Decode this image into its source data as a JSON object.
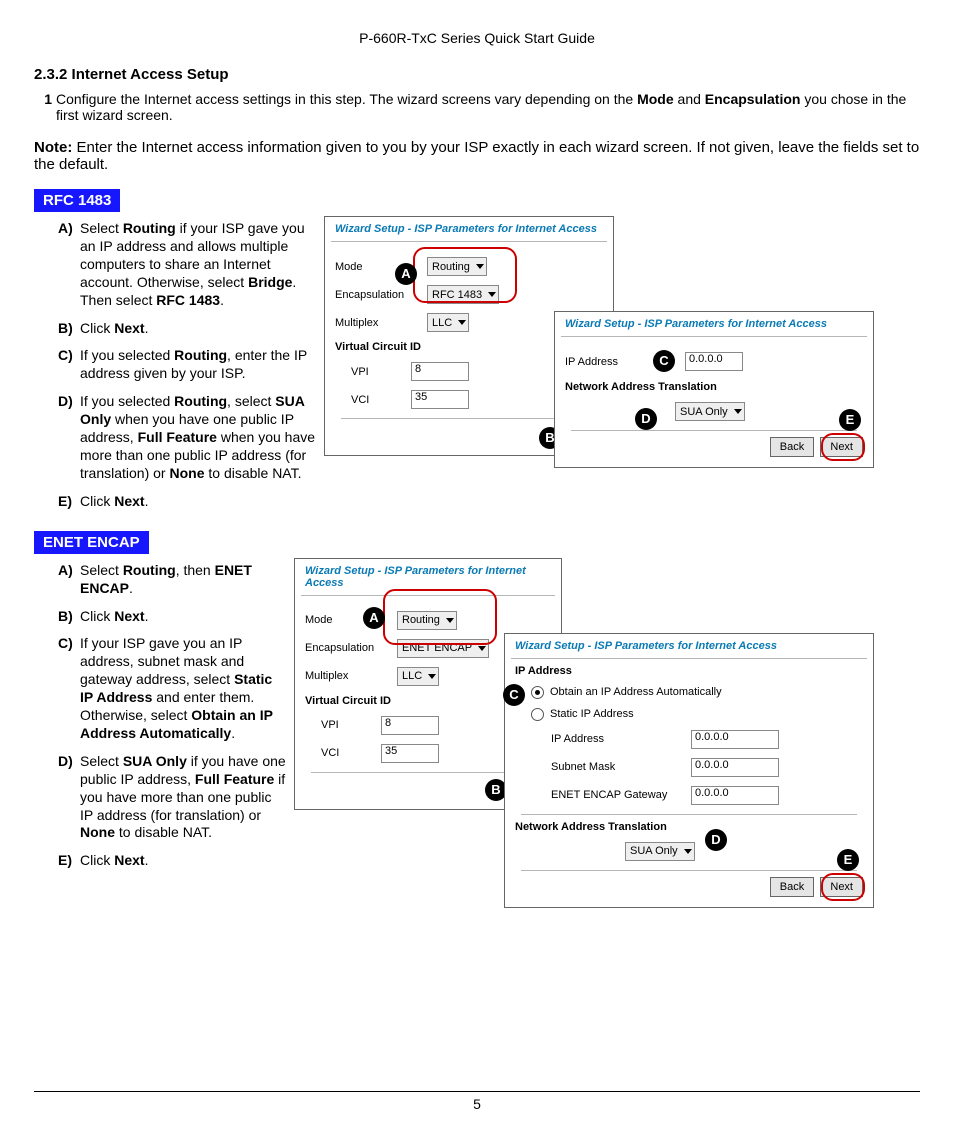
{
  "header": "P-660R-TxC Series Quick Start Guide",
  "page_number": "5",
  "heading": "2.3.2 Internet Access Setup",
  "step1_num": "1",
  "step1_a": "Configure the Internet access settings in this step. The wizard screens vary depending on the ",
  "step1_b": "Mode",
  "step1_c": " and ",
  "step1_d": "Encapsulation",
  "step1_e": " you chose in the first wizard screen.",
  "note_label": "Note:",
  "note_text": " Enter the Internet access information given to you by your ISP exactly in each wizard screen. If not given, leave the fields set to the default.",
  "rfc": {
    "tag": "RFC 1483",
    "A_pre": "Select ",
    "A_b1": "Routing",
    "A_mid": " if your ISP gave you an IP address and allows multiple computers to share an Internet account. Otherwise, select ",
    "A_b2": "Bridge",
    "A_mid2": ". Then select ",
    "A_b3": "RFC 1483",
    "A_end": ".",
    "B_pre": "Click ",
    "B_b": "Next",
    "B_end": ".",
    "C_pre": "If you selected ",
    "C_b": "Routing",
    "C_end": ", enter the IP address given by your ISP.",
    "D_pre": "If you selected ",
    "D_b1": "Routing",
    "D_mid": ", select ",
    "D_b2": "SUA Only",
    "D_mid2": " when you have one public IP address, ",
    "D_b3": "Full Feature",
    "D_mid3": " when you have more than one public IP address (for translation) or ",
    "D_b4": "None",
    "D_end": " to disable NAT.",
    "E_pre": "Click ",
    "E_b": "Next",
    "E_end": "."
  },
  "enet": {
    "tag": "ENET ENCAP",
    "A_pre": "Select ",
    "A_b1": "Routing",
    "A_mid": ", then ",
    "A_b2": "ENET ENCAP",
    "A_end": ".",
    "B_pre": "Click ",
    "B_b": "Next",
    "B_end": ".",
    "C_pre": "If your ISP gave you an IP address, subnet mask and gateway address, select ",
    "C_b1": "Static IP Address",
    "C_mid": " and enter them. Otherwise, select ",
    "C_b2": "Obtain an IP Address Automatically",
    "C_end": ".",
    "D_pre": "Select ",
    "D_b1": "SUA Only",
    "D_mid": " if you have one public IP address, ",
    "D_b2": "Full Feature",
    "D_mid2": " if you have more than one public IP address (for translation) or ",
    "D_b3": "None",
    "D_end": " to disable NAT.",
    "E_pre": "Click ",
    "E_b": "Next",
    "E_end": "."
  },
  "lbl": {
    "A": "A)",
    "B": "B)",
    "C": "C)",
    "D": "D)",
    "E": "E)",
    "bA": "A",
    "bB": "B",
    "bC": "C",
    "bD": "D",
    "bE": "E"
  },
  "dlg": {
    "title": "Wizard Setup - ISP Parameters for Internet Access",
    "mode": "Mode",
    "encap": "Encapsulation",
    "mux": "Multiplex",
    "vcid": "Virtual Circuit ID",
    "vpi": "VPI",
    "vci": "VCI",
    "routing": "Routing",
    "rfc1483": "RFC 1483",
    "enetencap": "ENET ENCAP",
    "llc": "LLC",
    "v8": "8",
    "v35": "35",
    "next": "Next",
    "back": "Back",
    "ip": "IP Address",
    "nat": "Network Address Translation",
    "sua": "SUA Only",
    "zero": "0.0.0.0",
    "obtain": "Obtain an IP Address Automatically",
    "static": "Static IP Address",
    "subnet": "Subnet Mask",
    "gw": "ENET ENCAP Gateway"
  }
}
